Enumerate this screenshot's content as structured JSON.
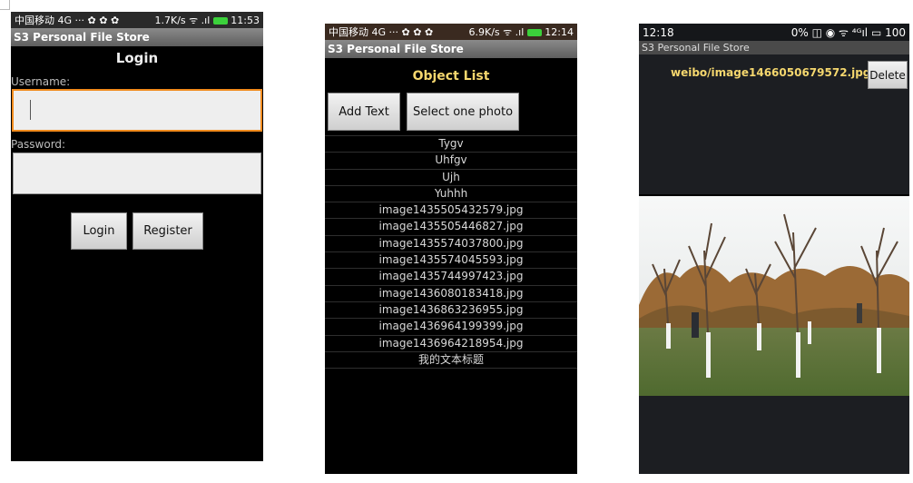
{
  "screen1": {
    "status": {
      "carrier": "中国移动 4G ··· ",
      "speed": "1.7K/s",
      "signal": "ᯤ .ıl",
      "time": "11:53"
    },
    "app_title": "S3 Personal File Store",
    "heading": "Login",
    "username_label": "Username:",
    "password_label": "Password:",
    "login_btn": "Login",
    "register_btn": "Register"
  },
  "screen2": {
    "status": {
      "carrier": "中国移动 4G ··· ",
      "speed": "6.9K/s",
      "signal": "ᯤ .ıl",
      "time": "12:14"
    },
    "app_title": "S3 Personal File Store",
    "heading": "Object List",
    "add_text_btn": "Add Text",
    "select_photo_btn": "Select one photo",
    "items": [
      "Tygv",
      "Uhfgv",
      "Ujh",
      "Yuhhh",
      "image1435505432579.jpg",
      "image1435505446827.jpg",
      "image1435574037800.jpg",
      "image1435574045593.jpg",
      "image1435744997423.jpg",
      "image1436080183418.jpg",
      "image1436863236955.jpg",
      "image1436964199399.jpg",
      "image1436964218954.jpg",
      "我的文本标题"
    ]
  },
  "screen3": {
    "status": {
      "time": "12:18",
      "icons": "0% ◫ ◉ ᯤ ⁴ᴳıl ▭ 100"
    },
    "app_title": "S3 Personal File Store",
    "object_name": "weibo/image1466050679572.jpg",
    "delete_btn": "Delete"
  },
  "colors": {
    "heading_yellow": "#f5d76e",
    "focus_orange": "#f08a1c",
    "phone_bg": "#000000"
  }
}
